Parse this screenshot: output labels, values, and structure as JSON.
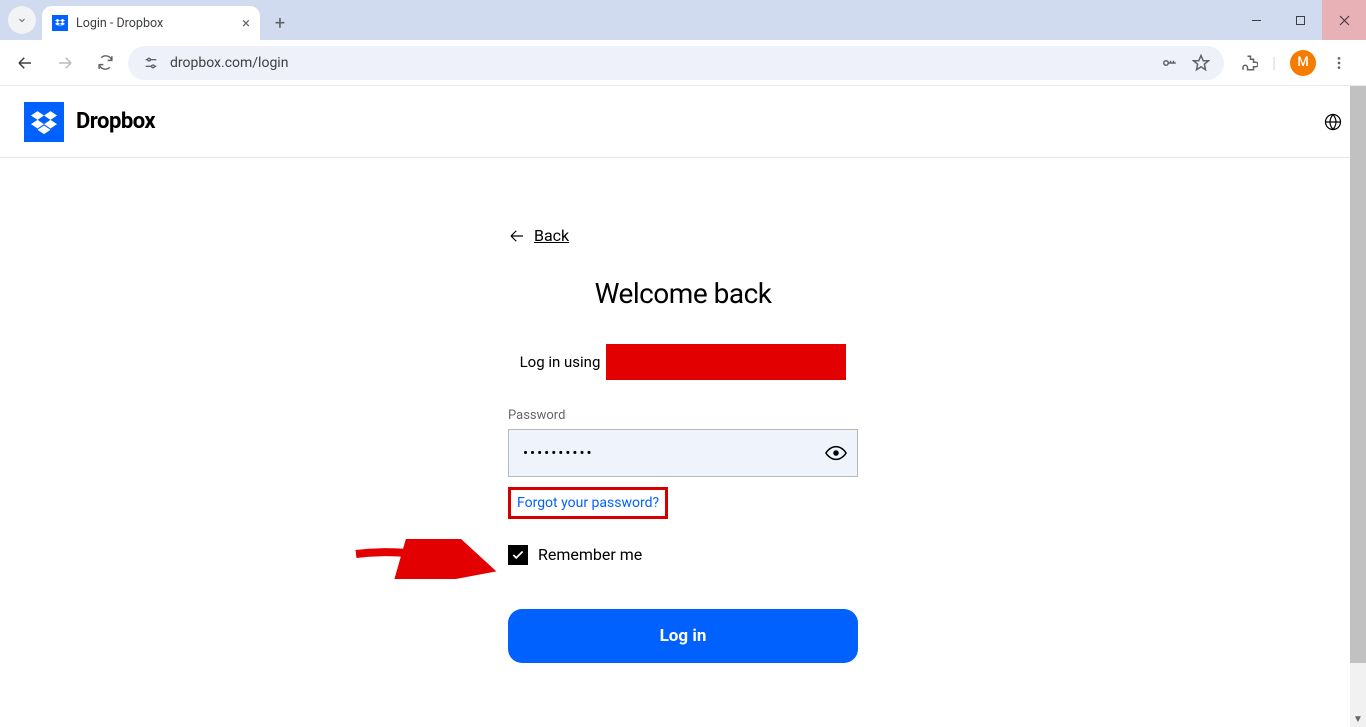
{
  "browser": {
    "tab_title": "Login - Dropbox",
    "url": "dropbox.com/login",
    "avatar_initial": "M"
  },
  "header": {
    "brand": "Dropbox"
  },
  "login": {
    "back_label": "Back",
    "heading": "Welcome back",
    "using_prefix": "Log in using",
    "password_label": "Password",
    "password_value": "••••••••••",
    "forgot_label": "Forgot your password?",
    "remember_label": "Remember me",
    "remember_checked": true,
    "submit_label": "Log in"
  }
}
